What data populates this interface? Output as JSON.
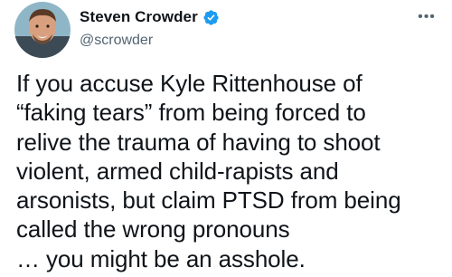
{
  "author": {
    "display_name": "Steven Crowder",
    "handle": "@scrowder",
    "verified": true
  },
  "icons": {
    "verified": "verified-badge-icon",
    "more": "more-options-icon",
    "more_glyph": "•••"
  },
  "colors": {
    "text": "#0f1419",
    "secondary": "#536471",
    "verified_blue": "#1d9bf0"
  },
  "tweet": {
    "text": "If you accuse Kyle Rittenhouse of\n“faking tears” from being forced to\nrelive the trauma of having to shoot\nviolent, armed child-rapists and\narsonists, but claim PTSD from being\ncalled the wrong pronouns\n… you might be an asshole."
  }
}
